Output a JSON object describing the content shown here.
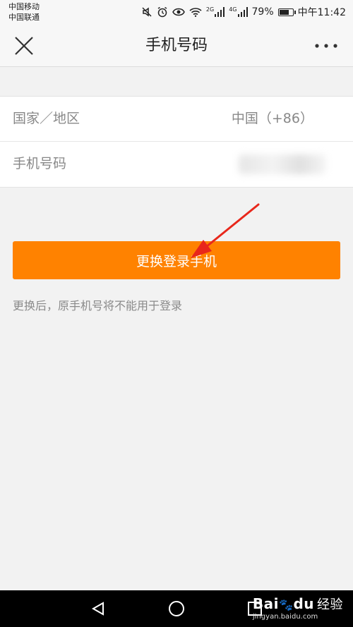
{
  "status_bar": {
    "carrier_1": "中国移动",
    "carrier_2": "中国联通",
    "net_1": "2G",
    "net_2": "4G",
    "battery": "79%",
    "battery_level": 0.79,
    "time": "中午11:42"
  },
  "header": {
    "title": "手机号码",
    "close_icon": "close-icon",
    "more_icon": "more-dots-icon"
  },
  "form": {
    "country_label": "国家／地区",
    "country_value": "中国（+86）",
    "phone_label": "手机号码",
    "phone_value": ""
  },
  "actions": {
    "change_button": "更换登录手机"
  },
  "hint": "更换后，原手机号将不能用于登录",
  "watermark": {
    "brand": "Bai",
    "brand_suffix": "du",
    "brand_cn": "经验",
    "url": "jingyan.baidu.com"
  },
  "colors": {
    "accent": "#ff8200",
    "background": "#f2f2f2",
    "annotation_arrow": "#e8271b"
  }
}
